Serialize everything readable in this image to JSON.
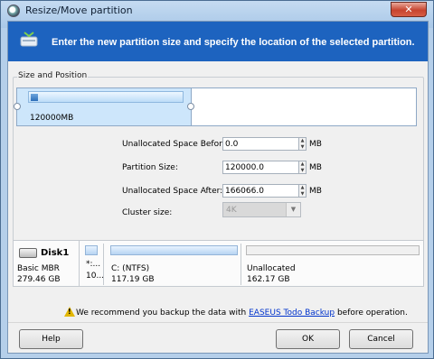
{
  "window": {
    "title": "Resize/Move partition",
    "close_label": "✕"
  },
  "banner": {
    "text": "Enter the new partition size and specify the location of the selected partition."
  },
  "group": {
    "legend": "Size and Position"
  },
  "map": {
    "partition_size": "120000MB"
  },
  "form": {
    "before_label": "Unallocated Space Before:",
    "before_value": "0.0",
    "size_label": "Partition Size:",
    "size_value": "120000.0",
    "after_label": "Unallocated Space After:",
    "after_value": "166066.0",
    "cluster_label": "Cluster size:",
    "cluster_value": "4K",
    "unit": "MB"
  },
  "disk": {
    "name": "Disk1",
    "type": "Basic MBR",
    "size": "279.46 GB",
    "segments": [
      {
        "label": "*:...",
        "size": "10..."
      },
      {
        "label": "C: (NTFS)",
        "size": "117.19 GB"
      },
      {
        "label": "Unallocated",
        "size": "162.17 GB"
      }
    ]
  },
  "note": {
    "prefix": "We recommend you backup the data with ",
    "link": "EASEUS Todo Backup",
    "suffix": " before operation."
  },
  "buttons": {
    "help": "Help",
    "ok": "OK",
    "cancel": "Cancel"
  }
}
